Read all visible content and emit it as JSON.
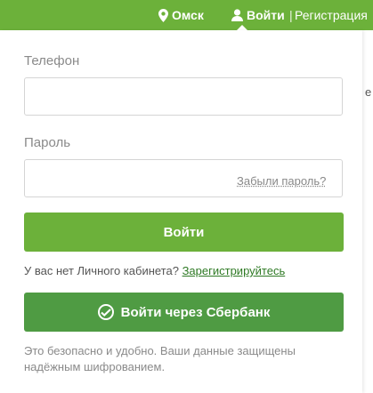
{
  "header": {
    "city": "Омск",
    "login": "Войти",
    "separator": "|",
    "register": "Регистрация"
  },
  "form": {
    "phone_label": "Телефон",
    "phone_value": "",
    "password_label": "Пароль",
    "password_value": "",
    "forgot_link": "Забыли пароль?",
    "login_button": "Войти",
    "no_account_text": "У вас нет Личного кабинета?",
    "register_link": "Зарегистрируйтесь",
    "sber_button": "Войти через Сбербанк",
    "security_note": "Это безопасно и удобно. Ваши данные защищены надёжным шифрованием."
  },
  "side": {
    "edge_text": "е"
  },
  "colors": {
    "brand_green": "#6cb13a",
    "sber_green": "#4f9b43",
    "link_green": "#2f7a25"
  },
  "icons": [
    "location-pin-icon",
    "user-icon",
    "sberbank-logo-icon"
  ]
}
